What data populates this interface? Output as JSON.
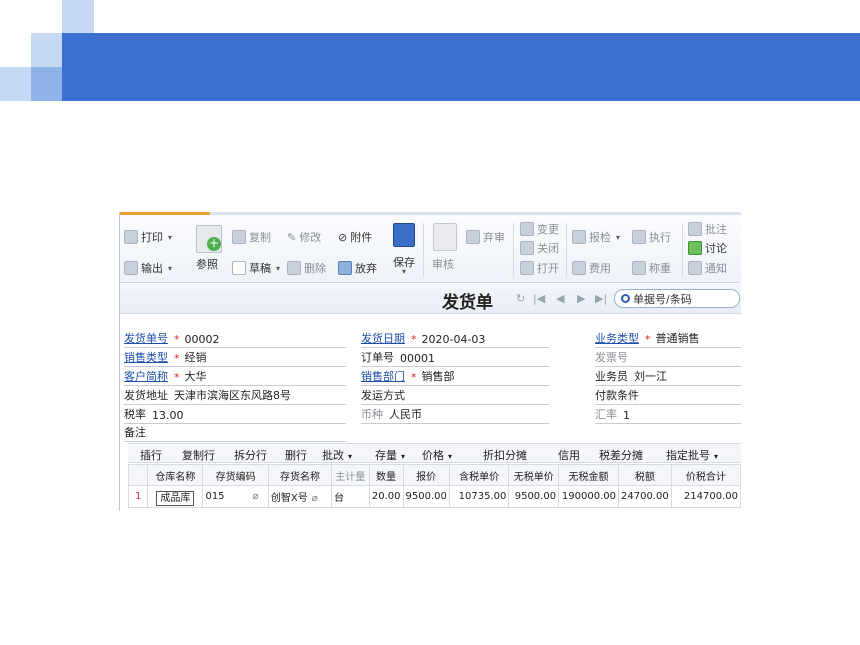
{
  "toolbar": {
    "print": "打印",
    "export": "输出",
    "reference": "参照",
    "copy": "复制",
    "draft": "草稿",
    "modify": "修改",
    "delete": "删除",
    "attachment": "附件",
    "discard": "放弃",
    "save": "保存",
    "review": "审核",
    "abandon_review": "弃审",
    "change": "变更",
    "close": "关闭",
    "open": "打开",
    "inspect": "报检",
    "execute": "执行",
    "expense": "费用",
    "weigh": "称重",
    "annotate": "批注",
    "discuss": "讨论",
    "notify": "通知"
  },
  "header": {
    "title": "发货单",
    "search_placeholder": "单据号/条码"
  },
  "form": {
    "doc_no_label": "发货单号",
    "doc_no": "00002",
    "date_label": "发货日期",
    "date": "2020-04-03",
    "biz_type_label": "业务类型",
    "biz_type": "普通销售",
    "sales_type_label": "销售类型",
    "sales_type": "经销",
    "order_no_label": "订单号",
    "order_no": "00001",
    "invoice_no_label": "发票号",
    "invoice_no": "",
    "customer_label": "客户简称",
    "customer": "大华",
    "dept_label": "销售部门",
    "dept": "销售部",
    "salesman_label": "业务员",
    "salesman": "刘一江",
    "address_label": "发货地址",
    "address": "天津市滨海区东风路8号",
    "shipping_label": "发运方式",
    "shipping": "",
    "payment_label": "付款条件",
    "payment": "",
    "tax_rate_label": "税率",
    "tax_rate": "13.00",
    "currency_label": "币种",
    "currency": "人民币",
    "exchange_label": "汇率",
    "exchange": "1",
    "remark_label": "备注",
    "remark": "",
    "required_mark": "*"
  },
  "grid_toolbar": {
    "insert": "插行",
    "copy_row": "复制行",
    "split_row": "拆分行",
    "delete_row": "删行",
    "batch_modify": "批改",
    "stock": "存量",
    "price": "价格",
    "discount": "折扣分摊",
    "credit": "信用",
    "tax_diff": "税差分摊",
    "batch_no": "指定批号"
  },
  "grid": {
    "columns": [
      "",
      "仓库名称",
      "存货编码",
      "存货名称",
      "主计量",
      "数量",
      "报价",
      "含税单价",
      "无税单价",
      "无税金额",
      "税额",
      "价税合计"
    ],
    "rows": [
      [
        "1",
        "成品库",
        "015",
        "创智X号",
        "台",
        "20.00",
        "9500.00",
        "10735.00",
        "9500.00",
        "190000.00",
        "24700.00",
        "214700.00"
      ]
    ]
  },
  "colors": {
    "band": "#3d6fd0",
    "square_light": "#c7d8f3",
    "square_mid": "#8fb2ea",
    "link": "#1d4fa8",
    "required": "#dd2222"
  }
}
